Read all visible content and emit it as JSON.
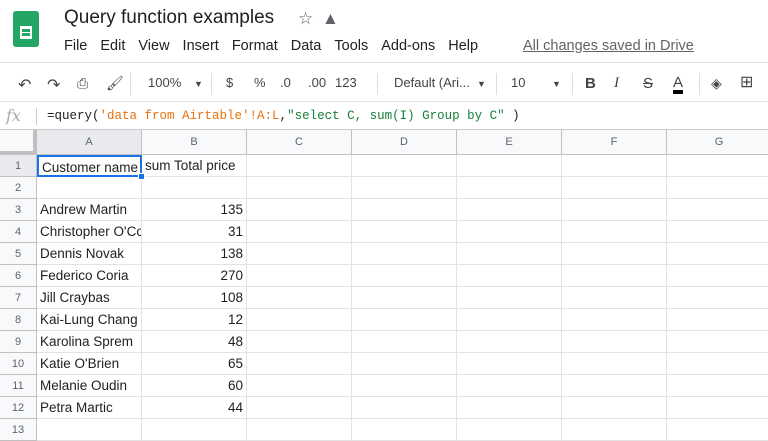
{
  "app": {
    "title": "Query function examples",
    "saved_status": "All changes saved in Drive"
  },
  "menu": [
    "File",
    "Edit",
    "View",
    "Insert",
    "Format",
    "Data",
    "Tools",
    "Add-ons",
    "Help"
  ],
  "toolbar": {
    "zoom": "100%",
    "currency": "$",
    "percent": "%",
    "dec_less": ".0",
    "dec_more": ".00",
    "format_more": "123",
    "font": "Default (Ari...",
    "font_size": "10",
    "bold": "B",
    "italic": "I",
    "strike": "S",
    "text_color": "A"
  },
  "formula_bar": {
    "fx": "fx",
    "prefix": "=query(",
    "range": "'data from Airtable'!A:L",
    "comma": ",",
    "query": "\"select C, sum(I) Group by C\"",
    "suffix": " )"
  },
  "columns": [
    "A",
    "B",
    "C",
    "D",
    "E",
    "F",
    "G"
  ],
  "rows": [
    [
      "Customer name",
      "sum Total price"
    ],
    [
      "",
      ""
    ],
    [
      "Andrew Martin",
      "135"
    ],
    [
      "Christopher O'Connor",
      "31"
    ],
    [
      "Dennis Novak",
      "138"
    ],
    [
      "Federico Coria",
      "270"
    ],
    [
      "Jill Craybas",
      "108"
    ],
    [
      "Kai-Lung Chang",
      "12"
    ],
    [
      "Karolina Sprem",
      "48"
    ],
    [
      "Katie O'Brien",
      "65"
    ],
    [
      "Melanie Oudin",
      "60"
    ],
    [
      "Petra Martic",
      "44"
    ],
    [
      "",
      ""
    ]
  ],
  "colors": {
    "sheets_green": "#23a566",
    "selection": "#1a73e8"
  }
}
